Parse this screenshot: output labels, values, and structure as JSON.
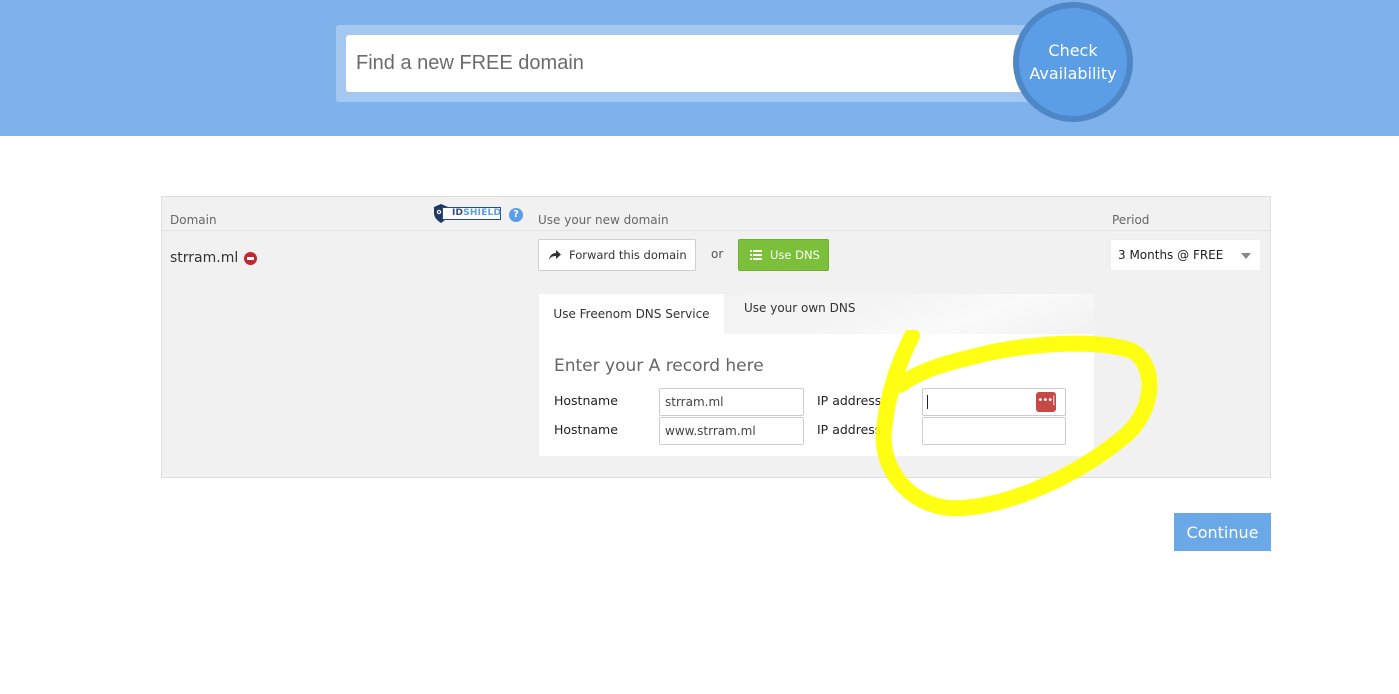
{
  "search": {
    "placeholder": "Find a new FREE domain",
    "button_line1": "Check",
    "button_line2": "Availability"
  },
  "table": {
    "headers": {
      "domain": "Domain",
      "idshield_logo": "IDSHIELD",
      "use": "Use your new domain",
      "period": "Period"
    },
    "row": {
      "domain": "strram.ml",
      "forward_label": "Forward this domain",
      "or": "or",
      "dns_label": "Use DNS",
      "period_value": "3 Months @ FREE"
    }
  },
  "dns": {
    "tabs": [
      "Use Freenom DNS Service",
      "Use your own DNS"
    ],
    "heading": "Enter your A record here",
    "records": [
      {
        "hostname_label": "Hostname",
        "hostname_value": "strram.ml",
        "ip_label": "IP address",
        "ip_value": ""
      },
      {
        "hostname_label": "Hostname",
        "hostname_value": "www.strram.ml",
        "ip_label": "IP address",
        "ip_value": ""
      }
    ]
  },
  "continue_label": "Continue",
  "colors": {
    "header_bg": "#7fb2eb",
    "accent_blue": "#5b9ee6",
    "dns_green": "#7bbf3b",
    "annotation_yellow": "#ffff00",
    "remove_red": "#c0282d"
  },
  "icons": {
    "forward": "share-arrow-icon",
    "dns": "list-icon",
    "help": "question-icon",
    "remove": "minus-circle-icon",
    "password_manager": "password-manager-icon"
  }
}
